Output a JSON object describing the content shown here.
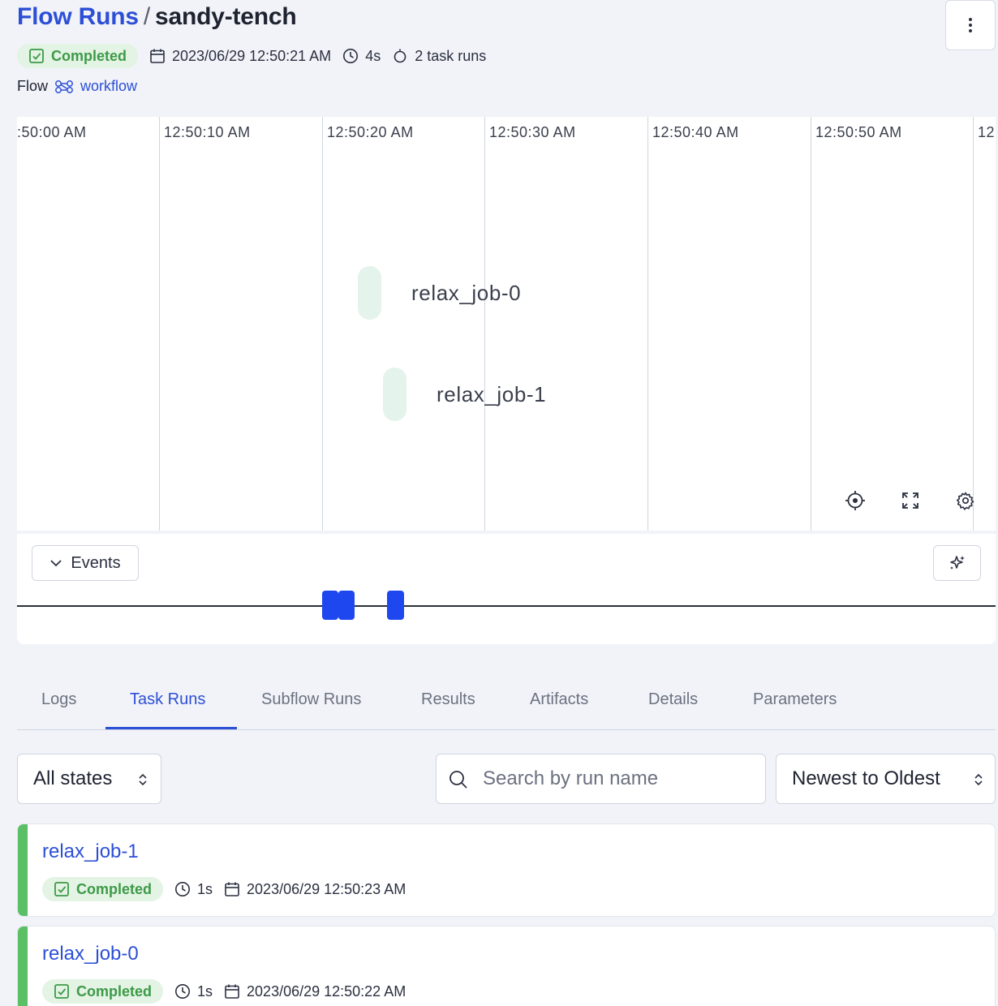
{
  "header": {
    "breadcrumb_root": "Flow Runs",
    "separator": "/",
    "run_name": "sandy-tench",
    "menu_icon": "kebab-vertical-icon"
  },
  "run_meta": {
    "state": "Completed",
    "start_time": "2023/06/29 12:50:21 AM",
    "duration": "4s",
    "task_runs": "2 task runs"
  },
  "flow": {
    "label": "Flow",
    "name": "workflow"
  },
  "timeline": {
    "ticks": [
      ":50:00 AM",
      "12:50:10 AM",
      "12:50:20 AM",
      "12:50:30 AM",
      "12:50:40 AM",
      "12:50:50 AM",
      "12"
    ],
    "nodes": [
      "relax_job-0",
      "relax_job-1"
    ],
    "controls": [
      "crosshair-icon",
      "fullscreen-icon",
      "settings-gear-icon"
    ]
  },
  "events": {
    "toggle_label": "Events",
    "sparkle_icon": "sparkle-icon"
  },
  "tabs": [
    "Logs",
    "Task Runs",
    "Subflow Runs",
    "Results",
    "Artifacts",
    "Details",
    "Parameters"
  ],
  "active_tab": "Task Runs",
  "filters": {
    "state_select": "All states",
    "search_placeholder": "Search by run name",
    "sort_select": "Newest to Oldest"
  },
  "task_runs": [
    {
      "name": "relax_job-1",
      "state": "Completed",
      "duration": "1s",
      "start": "2023/06/29 12:50:23 AM"
    },
    {
      "name": "relax_job-0",
      "state": "Completed",
      "duration": "1s",
      "start": "2023/06/29 12:50:22 AM"
    }
  ],
  "colors": {
    "accent": "#2c4fd6",
    "success": "#3d9a47",
    "success_bg": "#e3f3e4",
    "event_mark": "#1f47f0",
    "node_fill": "#e4f4ec"
  }
}
